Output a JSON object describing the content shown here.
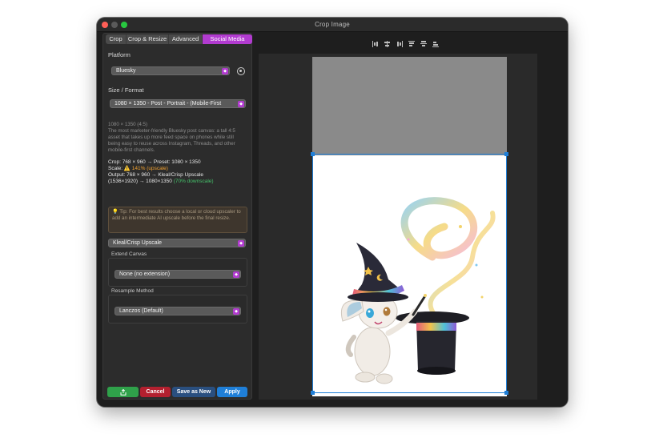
{
  "window": {
    "title": "Crop Image"
  },
  "tabs": [
    "Crop",
    "Crop & Resize",
    "Advanced",
    "Social Media"
  ],
  "active_tab": "Social Media",
  "platform": {
    "label": "Platform",
    "value": "Bluesky"
  },
  "size_format": {
    "label": "Size / Format",
    "value": "1080 × 1350 - Post - Portrait - (Mobile-First"
  },
  "description": {
    "dims": "1080 × 1350 (4:5)",
    "text": "The most marketer-friendly Bluesky post canvas: a tall 4:5 asset that takes up more feed space on phones while still being easy to reuse across Instagram, Threads, and other mobile-first channels."
  },
  "info": {
    "crop": "Crop: 768 × 960 → Preset: 1080 × 1350",
    "scale_prefix": "Scale: ",
    "scale_warn": "⚠️ 141% (upscale)",
    "output": "Output: 768 × 960 → Kleal/Crisp Upscale",
    "output2_prefix": "(1536×1920) → 1080×1350 ",
    "output2_green": "(70% downscale)"
  },
  "tip": "💡 Tip: For best results choose a local or cloud upscaler to add an intermediate AI upscale before the final resize.",
  "upscaler": {
    "value": "Kleal/Crisp Upscale"
  },
  "extend_canvas": {
    "label": "Extend Canvas",
    "value": "None (no extension)"
  },
  "resample": {
    "label": "Resample Method",
    "value": "Lanczos (Default)"
  },
  "buttons": {
    "cancel": "Cancel",
    "save_as_new": "Save as New",
    "apply": "Apply"
  },
  "colors": {
    "accent": "#b23bd0",
    "crop_border": "#1f7fd8",
    "apply": "#1f7fd8",
    "cancel": "#b3202f",
    "share": "#2fa14a"
  }
}
